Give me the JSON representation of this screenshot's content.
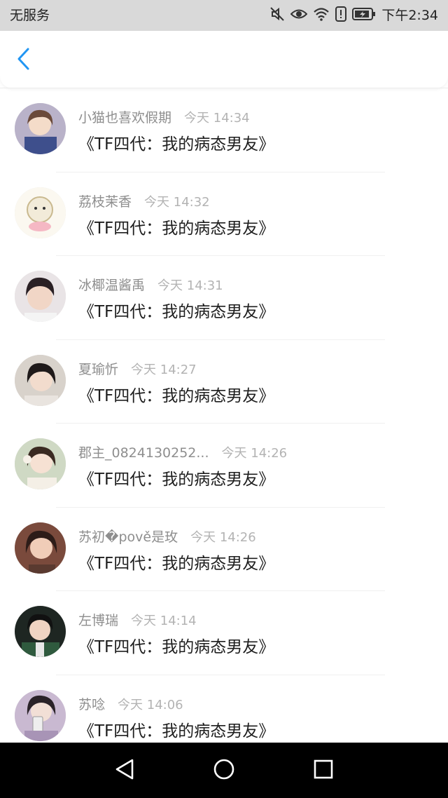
{
  "status_bar": {
    "carrier": "无服务",
    "time": "下午2:34",
    "icons": [
      "mute-icon",
      "eye-icon",
      "wifi-icon",
      "sim-alert-icon",
      "battery-charging-icon"
    ]
  },
  "header": {
    "back_icon": "chevron-left-icon",
    "accent_color": "#2196f3"
  },
  "messages": [
    {
      "name": "小猫也喜欢假期",
      "time": "今天 14:34",
      "text": "《TF四代：我的病态男友》"
    },
    {
      "name": "荔枝茉香",
      "time": "今天 14:32",
      "text": "《TF四代：我的病态男友》"
    },
    {
      "name": "冰椰温酱禹",
      "time": "今天 14:31",
      "text": "《TF四代：我的病态男友》"
    },
    {
      "name": "夏瑜忻",
      "time": "今天 14:27",
      "text": "《TF四代：我的病态男友》"
    },
    {
      "name": "郡主_0824130252...",
      "time": "今天 14:26",
      "text": "《TF四代：我的病态男友》"
    },
    {
      "name": "苏初�pově是玫",
      "time": "今天 14:26",
      "text": "《TF四代：我的病态男友》"
    },
    {
      "name": "左博瑞",
      "time": "今天 14:14",
      "text": "《TF四代：我的病态男友》"
    },
    {
      "name": "苏唸",
      "time": "今天 14:06",
      "text": "《TF四代：我的病态男友》"
    }
  ],
  "nav_bar": {
    "icons": [
      "back-triangle-icon",
      "home-circle-icon",
      "recents-square-icon"
    ]
  }
}
